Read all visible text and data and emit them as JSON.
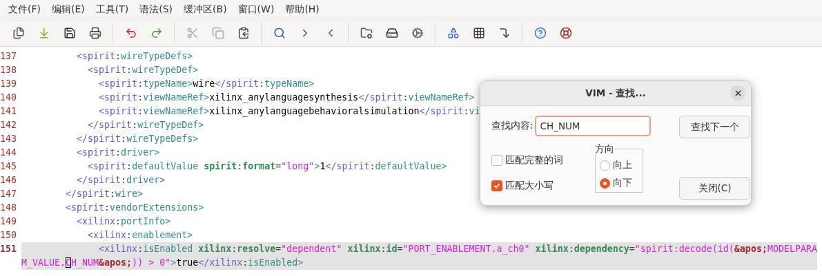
{
  "menu": [
    "文件(F)",
    "编辑(E)",
    "工具(T)",
    "语法(S)",
    "缓冲区(B)",
    "窗口(W)",
    "帮助(H)"
  ],
  "editor": {
    "lines": [
      {
        "number": "137",
        "current": false,
        "rows": [
          {
            "segments": [
              {
                "kind": "ns",
                "text": "          <spirit"
              },
              {
                "kind": "p",
                "text": ":"
              },
              {
                "kind": "tag",
                "text": "wireTypeDefs>"
              }
            ]
          }
        ]
      },
      {
        "number": "138",
        "current": false,
        "rows": [
          {
            "segments": [
              {
                "kind": "ns",
                "text": "            <spirit"
              },
              {
                "kind": "p",
                "text": ":"
              },
              {
                "kind": "tag",
                "text": "wireTypeDef>"
              }
            ]
          }
        ]
      },
      {
        "number": "139",
        "current": false,
        "rows": [
          {
            "segments": [
              {
                "kind": "ns",
                "text": "              <spirit"
              },
              {
                "kind": "p",
                "text": ":"
              },
              {
                "kind": "tag",
                "text": "typeName>"
              },
              {
                "kind": "text",
                "text": "wire"
              },
              {
                "kind": "ns",
                "text": "</spirit"
              },
              {
                "kind": "p",
                "text": ":"
              },
              {
                "kind": "tag",
                "text": "typeName>"
              }
            ]
          }
        ]
      },
      {
        "number": "140",
        "current": false,
        "rows": [
          {
            "segments": [
              {
                "kind": "ns",
                "text": "              <spirit"
              },
              {
                "kind": "p",
                "text": ":"
              },
              {
                "kind": "tag",
                "text": "viewNameRef>"
              },
              {
                "kind": "text",
                "text": "xilinx_anylanguagesynthesis"
              },
              {
                "kind": "ns",
                "text": "</spirit"
              },
              {
                "kind": "p",
                "text": ":"
              },
              {
                "kind": "tag",
                "text": "viewNameRef>"
              }
            ]
          }
        ]
      },
      {
        "number": "141",
        "current": false,
        "rows": [
          {
            "segments": [
              {
                "kind": "ns",
                "text": "              <spirit"
              },
              {
                "kind": "p",
                "text": ":"
              },
              {
                "kind": "tag",
                "text": "viewNameRef>"
              },
              {
                "kind": "text",
                "text": "xilinx_anylanguagebehavioralsimulation"
              },
              {
                "kind": "ns",
                "text": "</spirit"
              },
              {
                "kind": "p",
                "text": ":"
              },
              {
                "kind": "tag",
                "text": "vi"
              }
            ]
          }
        ]
      },
      {
        "number": "142",
        "current": false,
        "rows": [
          {
            "segments": [
              {
                "kind": "ns",
                "text": "            </spirit"
              },
              {
                "kind": "p",
                "text": ":"
              },
              {
                "kind": "tag",
                "text": "wireTypeDef>"
              }
            ]
          }
        ]
      },
      {
        "number": "143",
        "current": false,
        "rows": [
          {
            "segments": [
              {
                "kind": "ns",
                "text": "          </spirit"
              },
              {
                "kind": "p",
                "text": ":"
              },
              {
                "kind": "tag",
                "text": "wireTypeDefs>"
              }
            ]
          }
        ]
      },
      {
        "number": "144",
        "current": false,
        "rows": [
          {
            "segments": [
              {
                "kind": "ns",
                "text": "          <spirit"
              },
              {
                "kind": "p",
                "text": ":"
              },
              {
                "kind": "tag",
                "text": "driver>"
              }
            ]
          }
        ]
      },
      {
        "number": "145",
        "current": false,
        "rows": [
          {
            "segments": [
              {
                "kind": "ns",
                "text": "            <spirit"
              },
              {
                "kind": "p",
                "text": ":"
              },
              {
                "kind": "tag",
                "text": "defaultValue"
              },
              {
                "kind": "attr",
                "text": " spirit"
              },
              {
                "kind": "p",
                "text": ":"
              },
              {
                "kind": "attr",
                "text": "format"
              },
              {
                "kind": "p",
                "text": "="
              },
              {
                "kind": "str",
                "text": "\"long\""
              },
              {
                "kind": "tag",
                "text": ">"
              },
              {
                "kind": "text",
                "text": "1"
              },
              {
                "kind": "ns",
                "text": "</spirit"
              },
              {
                "kind": "p",
                "text": ":"
              },
              {
                "kind": "tag",
                "text": "defaultValue>"
              }
            ]
          }
        ]
      },
      {
        "number": "146",
        "current": false,
        "rows": [
          {
            "segments": [
              {
                "kind": "ns",
                "text": "          </spirit"
              },
              {
                "kind": "p",
                "text": ":"
              },
              {
                "kind": "tag",
                "text": "driver>"
              }
            ]
          }
        ]
      },
      {
        "number": "147",
        "current": false,
        "rows": [
          {
            "segments": [
              {
                "kind": "ns",
                "text": "        </spirit"
              },
              {
                "kind": "p",
                "text": ":"
              },
              {
                "kind": "tag",
                "text": "wire>"
              }
            ]
          }
        ]
      },
      {
        "number": "148",
        "current": false,
        "rows": [
          {
            "segments": [
              {
                "kind": "ns",
                "text": "        <spirit"
              },
              {
                "kind": "p",
                "text": ":"
              },
              {
                "kind": "tag",
                "text": "vendorExtensions>"
              }
            ]
          }
        ]
      },
      {
        "number": "149",
        "current": false,
        "rows": [
          {
            "segments": [
              {
                "kind": "ns",
                "text": "          <xilinx"
              },
              {
                "kind": "p",
                "text": ":"
              },
              {
                "kind": "tag",
                "text": "portInfo>"
              }
            ]
          }
        ]
      },
      {
        "number": "150",
        "current": false,
        "rows": [
          {
            "segments": [
              {
                "kind": "ns",
                "text": "            <xilinx"
              },
              {
                "kind": "p",
                "text": ":"
              },
              {
                "kind": "tag",
                "text": "enablement>"
              }
            ]
          }
        ]
      },
      {
        "number": "151",
        "current": true,
        "rows": [
          {
            "segments": [
              {
                "kind": "ns",
                "text": "              <xilinx"
              },
              {
                "kind": "p",
                "text": ":"
              },
              {
                "kind": "tag",
                "text": "isEnabled"
              },
              {
                "kind": "attr",
                "text": " xilinx"
              },
              {
                "kind": "p",
                "text": ":"
              },
              {
                "kind": "attr",
                "text": "resolve"
              },
              {
                "kind": "p",
                "text": "="
              },
              {
                "kind": "str",
                "text": "\"dependent\""
              },
              {
                "kind": "attr",
                "text": " xilinx"
              },
              {
                "kind": "p",
                "text": ":"
              },
              {
                "kind": "attr",
                "text": "id"
              },
              {
                "kind": "p",
                "text": "="
              },
              {
                "kind": "str",
                "text": "\"PORT_ENABLEMENT.a_ch0\""
              },
              {
                "kind": "attr",
                "text": " xilinx"
              },
              {
                "kind": "p",
                "text": ":"
              },
              {
                "kind": "attr",
                "text": "dependency"
              },
              {
                "kind": "p",
                "text": "="
              },
              {
                "kind": "str",
                "text": "\"spirit:decode(id("
              },
              {
                "kind": "ent",
                "text": "&apos;"
              },
              {
                "kind": "str",
                "text": "MODELPARA"
              }
            ]
          },
          {
            "segments": [
              {
                "kind": "str",
                "text": "M_VALUE."
              },
              {
                "kind": "cursor",
                "text": "C"
              },
              {
                "kind": "str",
                "text": "H_NUM"
              },
              {
                "kind": "ent",
                "text": "&apos;"
              },
              {
                "kind": "str",
                "text": ")) > 0\""
              },
              {
                "kind": "tag",
                "text": ">"
              },
              {
                "kind": "text",
                "text": "true"
              },
              {
                "kind": "ns",
                "text": "</xilinx"
              },
              {
                "kind": "p",
                "text": ":"
              },
              {
                "kind": "tag",
                "text": "isEnabled>"
              }
            ]
          }
        ]
      }
    ]
  },
  "dialog": {
    "title": "VIM - 查找...",
    "find_field": {
      "label": "查找内容:",
      "value": "CH_NUM"
    },
    "options": [
      {
        "label": "匹配完整的词",
        "checked": false
      },
      {
        "label": "匹配大小写",
        "checked": true
      }
    ],
    "direction": {
      "label": "方向",
      "options": [
        {
          "label": "向上",
          "selected": false
        },
        {
          "label": "向下",
          "selected": true
        }
      ]
    },
    "buttons": [
      "查找下一个",
      "关闭(C)"
    ]
  }
}
